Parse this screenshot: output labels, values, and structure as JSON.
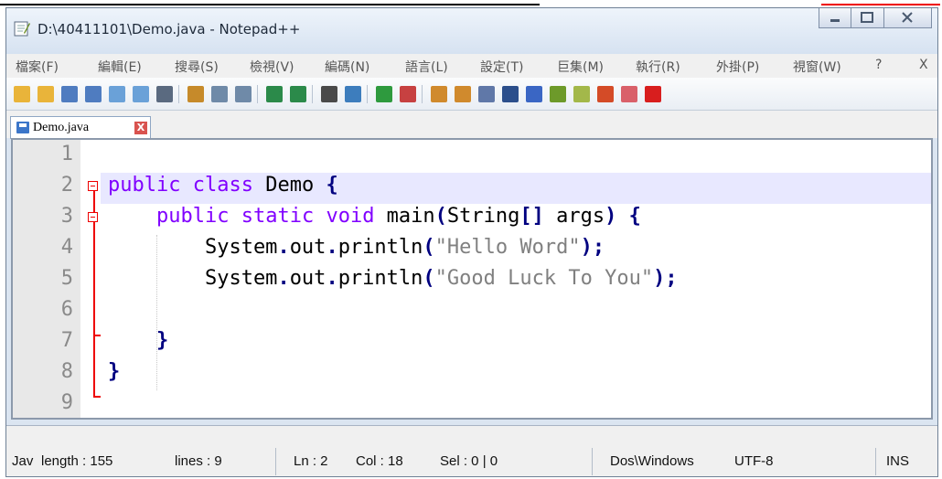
{
  "window": {
    "title": "D:\\40411101\\Demo.java - Notepad++"
  },
  "menu": [
    "檔案(F)",
    "編輯(E)",
    "搜尋(S)",
    "檢視(V)",
    "編碼(N)",
    "語言(L)",
    "設定(T)",
    "巨集(M)",
    "執行(R)",
    "外掛(P)",
    "視窗(W)",
    "?",
    "X"
  ],
  "toolbar": {
    "icons": [
      "new-file-icon",
      "open-file-icon",
      "save-icon",
      "save-all-icon",
      "close-icon",
      "close-all-icon",
      "print-icon",
      "cut-icon",
      "copy-icon",
      "paste-icon",
      "undo-icon",
      "redo-icon",
      "find-icon",
      "replace-icon",
      "zoom-in-icon",
      "zoom-out-icon",
      "sync-vertical-icon",
      "sync-horizontal-icon",
      "word-wrap-icon",
      "show-all-chars-icon",
      "indent-guide-icon",
      "user-language-icon",
      "document-map-icon",
      "function-list-icon",
      "folder-workspace-icon",
      "record-macro-icon"
    ]
  },
  "tab": {
    "label": "Demo.java",
    "close": "X"
  },
  "editor": {
    "line_numbers": [
      "1",
      "2",
      "3",
      "4",
      "5",
      "6",
      "7",
      "8",
      "9"
    ],
    "current_line": 2,
    "lines": [
      {
        "tokens": []
      },
      {
        "tokens": [
          [
            "kw",
            "public"
          ],
          [
            "t",
            " "
          ],
          [
            "kw",
            "class"
          ],
          [
            "t",
            " Demo "
          ],
          [
            "op",
            "{"
          ]
        ]
      },
      {
        "tokens": [
          [
            "t",
            "    "
          ],
          [
            "kw",
            "public"
          ],
          [
            "t",
            " "
          ],
          [
            "kw",
            "static"
          ],
          [
            "t",
            " "
          ],
          [
            "kw",
            "void"
          ],
          [
            "t",
            " main"
          ],
          [
            "op",
            "("
          ],
          [
            "t",
            "String"
          ],
          [
            "op",
            "[]"
          ],
          [
            "t",
            " args"
          ],
          [
            "op",
            ")"
          ],
          [
            "t",
            " "
          ],
          [
            "op",
            "{"
          ]
        ]
      },
      {
        "tokens": [
          [
            "t",
            "        System"
          ],
          [
            "op",
            "."
          ],
          [
            "t",
            "out"
          ],
          [
            "op",
            "."
          ],
          [
            "t",
            "println"
          ],
          [
            "op",
            "("
          ],
          [
            "str",
            "\"Hello Word\""
          ],
          [
            "op",
            ");"
          ]
        ]
      },
      {
        "tokens": [
          [
            "t",
            "        System"
          ],
          [
            "op",
            "."
          ],
          [
            "t",
            "out"
          ],
          [
            "op",
            "."
          ],
          [
            "t",
            "println"
          ],
          [
            "op",
            "("
          ],
          [
            "str",
            "\"Good Luck To You\""
          ],
          [
            "op",
            ");"
          ]
        ]
      },
      {
        "tokens": []
      },
      {
        "tokens": [
          [
            "t",
            "    "
          ],
          [
            "op",
            "}"
          ]
        ]
      },
      {
        "tokens": [
          [
            "op",
            "}"
          ]
        ]
      },
      {
        "tokens": []
      }
    ]
  },
  "status": {
    "type": "Jav",
    "length": "length : 155",
    "lines": "lines : 9",
    "ln": "Ln : 2",
    "col": "Col : 18",
    "sel": "Sel : 0 | 0",
    "eol": "Dos\\Windows",
    "encoding": "UTF-8",
    "mode": "INS"
  }
}
